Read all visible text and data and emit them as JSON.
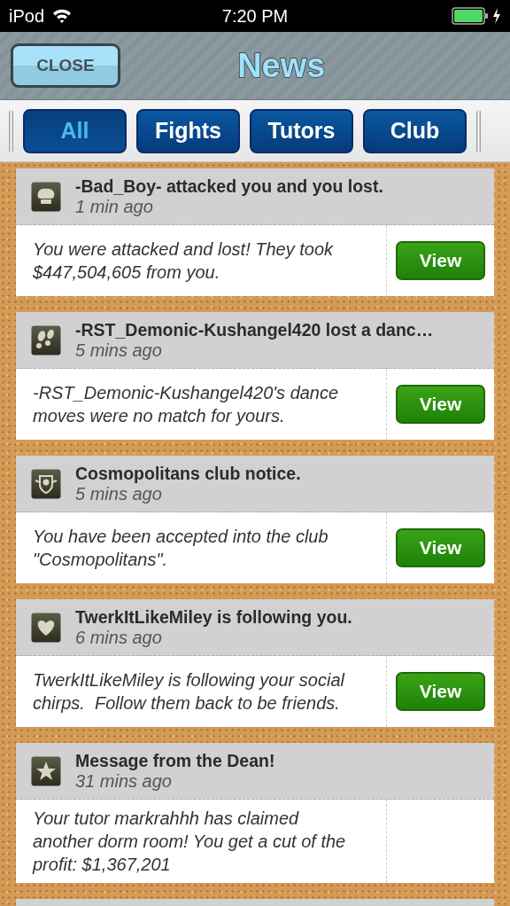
{
  "status_bar": {
    "device": "iPod",
    "time": "7:20 PM",
    "battery_charging": true
  },
  "header": {
    "close_button": "CLOSE",
    "title": "News"
  },
  "tabs": [
    {
      "label": "All",
      "selected": true
    },
    {
      "label": "Fights",
      "selected": false
    },
    {
      "label": "Tutors",
      "selected": false
    },
    {
      "label": "Club",
      "selected": false
    }
  ],
  "news": [
    {
      "kind": "glove",
      "title": "-Bad_Boy- attacked you and you lost.",
      "time": "1 min ago",
      "message": "You were attacked and lost! They took $447,504,605 from you.",
      "button": "View"
    },
    {
      "kind": "footprints",
      "title": "-RST_Demonic-Kushangel420 lost a danc…",
      "time": "5 mins ago",
      "message": "-RST_Demonic-Kushangel420's dance moves were no match for yours.",
      "button": "View"
    },
    {
      "kind": "crest",
      "title": "Cosmopolitans club notice.",
      "time": "5 mins ago",
      "message": "You have been accepted into the club \"Cosmopolitans\".",
      "button": "View"
    },
    {
      "kind": "heart",
      "title": "TwerkItLikeMiley is following you.",
      "time": "6 mins ago",
      "message": "TwerkItLikeMiley is following your social chirps.  Follow them back to be friends.",
      "button": "View"
    },
    {
      "kind": "star",
      "title": "Message from the Dean!",
      "time": "31 mins ago",
      "message": "Your tutor markrahhh has claimed another dorm room! You get a cut of the profit: $1,367,201"
    }
  ],
  "partial_card_below": true
}
